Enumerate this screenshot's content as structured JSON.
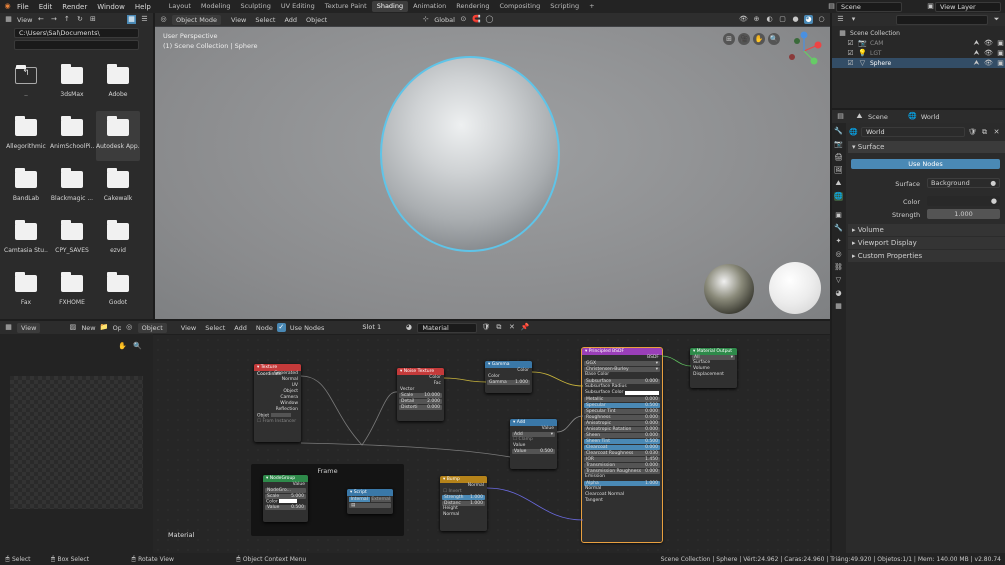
{
  "menu": [
    "File",
    "Edit",
    "Render",
    "Window",
    "Help"
  ],
  "workspaces": [
    "Layout",
    "Modeling",
    "Sculpting",
    "UV Editing",
    "Texture Paint",
    "Shading",
    "Animation",
    "Rendering",
    "Compositing",
    "Scripting"
  ],
  "active_workspace": "Shading",
  "add_tab": "+",
  "scene": "Scene",
  "view_layer": "View Layer",
  "filebrowser": {
    "view_label": "View",
    "path": "C:\\Users\\Sal\\Documents\\",
    "items": [
      "..",
      "3dsMax",
      "Adobe",
      "Allegorithmic",
      "AnimSchoolPi...",
      "Autodesk App...",
      "BandLab",
      "Blackmagic ...",
      "Cakewalk",
      "Camtasia Stu...",
      "CPY_SAVES",
      "ezvid",
      "Fax",
      "FXHOME",
      "Godot"
    ]
  },
  "viewport": {
    "mode": "Object Mode",
    "menus": [
      "View",
      "Select",
      "Add",
      "Object"
    ],
    "orientation": "Global",
    "title": "User Perspective",
    "subtitle": "(1) Scene Collection | Sphere"
  },
  "outliner": {
    "root": "Scene Collection",
    "items": [
      "CAM",
      "LGT",
      "Sphere"
    ]
  },
  "properties": {
    "context": "Scene",
    "world_label": "World",
    "world_name": "World",
    "surface": "Surface",
    "use_nodes": "Use Nodes",
    "surface_label": "Surface",
    "surface_value": "Background",
    "color_label": "Color",
    "strength_label": "Strength",
    "strength_value": "1.000",
    "panels": [
      "Volume",
      "Viewport Display",
      "Custom Properties"
    ]
  },
  "node_header": {
    "view": "View",
    "new": "New",
    "open": "Open",
    "object": "Object",
    "menus": [
      "View",
      "Select",
      "Add",
      "Node"
    ],
    "use_nodes": "Use Nodes",
    "slot": "Slot 1",
    "material": "Material"
  },
  "nodes": {
    "texcoord": {
      "title": "Texture Coordinate",
      "outputs": [
        "Generated",
        "Normal",
        "UV",
        "Object",
        "Camera",
        "Window",
        "Reflection"
      ],
      "object": "Objet",
      "from_instancer": "From Instancer"
    },
    "noise": {
      "title": "Noise Texture",
      "outputs": [
        "Color",
        "Fac"
      ],
      "vector": "Vector",
      "scale": "Scale",
      "scale_v": "10.000",
      "detail": "Detail",
      "detail_v": "2.000",
      "distortion": "Distorti",
      "distortion_v": "0.000"
    },
    "gamma": {
      "title": "Gamma",
      "color": "Color",
      "gamma": "Gamma",
      "gamma_v": "1.000"
    },
    "add": {
      "title": "Add",
      "value": "Value",
      "op": "Add",
      "clamp": "Clamp",
      "value_in": "Value",
      "value_v": "0.500"
    },
    "bsdf": {
      "title": "Principled BSDF",
      "out": "BSDF",
      "dist": "GGX",
      "sss_method": "Christensen-Burley",
      "rows": [
        [
          "Base Color",
          ""
        ],
        [
          "Subsurface",
          "0.000"
        ],
        [
          "Subsurface Radius",
          ""
        ],
        [
          "Subsurface Color",
          ""
        ],
        [
          "Metallic",
          "0.000"
        ],
        [
          "Specular",
          "0.500"
        ],
        [
          "Specular Tint",
          "0.000"
        ],
        [
          "Roughness",
          "0.000"
        ],
        [
          "Anisotropic",
          "0.000"
        ],
        [
          "Anisotropic Rotation",
          "0.000"
        ],
        [
          "Sheen",
          "0.000"
        ],
        [
          "Sheen Tint",
          "0.500"
        ],
        [
          "Clearcoat",
          "0.000"
        ],
        [
          "Clearcoat Roughness",
          "0.030"
        ],
        [
          "IOR",
          "1.450"
        ],
        [
          "Transmission",
          "0.000"
        ],
        [
          "Transmission Roughness",
          "0.000"
        ],
        [
          "Emission",
          ""
        ],
        [
          "Alpha",
          "1.000"
        ],
        [
          "Normal",
          ""
        ],
        [
          "Clearcoat Normal",
          ""
        ],
        [
          "Tangent",
          ""
        ]
      ]
    },
    "output": {
      "title": "Material Output",
      "target": "All",
      "inputs": [
        "Surface",
        "Volume",
        "Displacement"
      ]
    },
    "frame": {
      "title": "Frame"
    },
    "group": {
      "title": "NodeGroup",
      "value": "Value",
      "name": "NodeGro...",
      "scale": "Scale",
      "scale_v": "5.000",
      "color": "Color",
      "value_in": "Value",
      "value_v": "0.500"
    },
    "script": {
      "title": "Script",
      "internal": "Internal",
      "external": "External"
    },
    "bump": {
      "title": "Bump",
      "normal": "Normal",
      "invert": "Invert",
      "strength": "Strength",
      "strength_v": "1.000",
      "distance": "Distanc",
      "distance_v": "1.000",
      "height": "Height",
      "normal_in": "Normal"
    }
  },
  "node_editor_label": "Material",
  "status": {
    "select": "Select",
    "box_select": "Box Select",
    "rotate": "Rotate View",
    "context_menu": "Object Context Menu",
    "stats": "Scene Collection | Sphere | Vért:24.962 | Caras:24.960 | Triáng:49.920 | Objetos:1/1 | Mem: 140.00 MB | v2.80.74"
  },
  "colors": {
    "accent": "#4a89b5",
    "texture_node": "#c43a3a",
    "color_node": "#3a78a8",
    "input_node": "#2e8a4a",
    "shader_node": "#9a3fb8",
    "output_node": "#2e8a4a",
    "vector_node": "#b5831a",
    "converter_node": "#3a78a8",
    "active_tab": "#3d3d3d"
  }
}
